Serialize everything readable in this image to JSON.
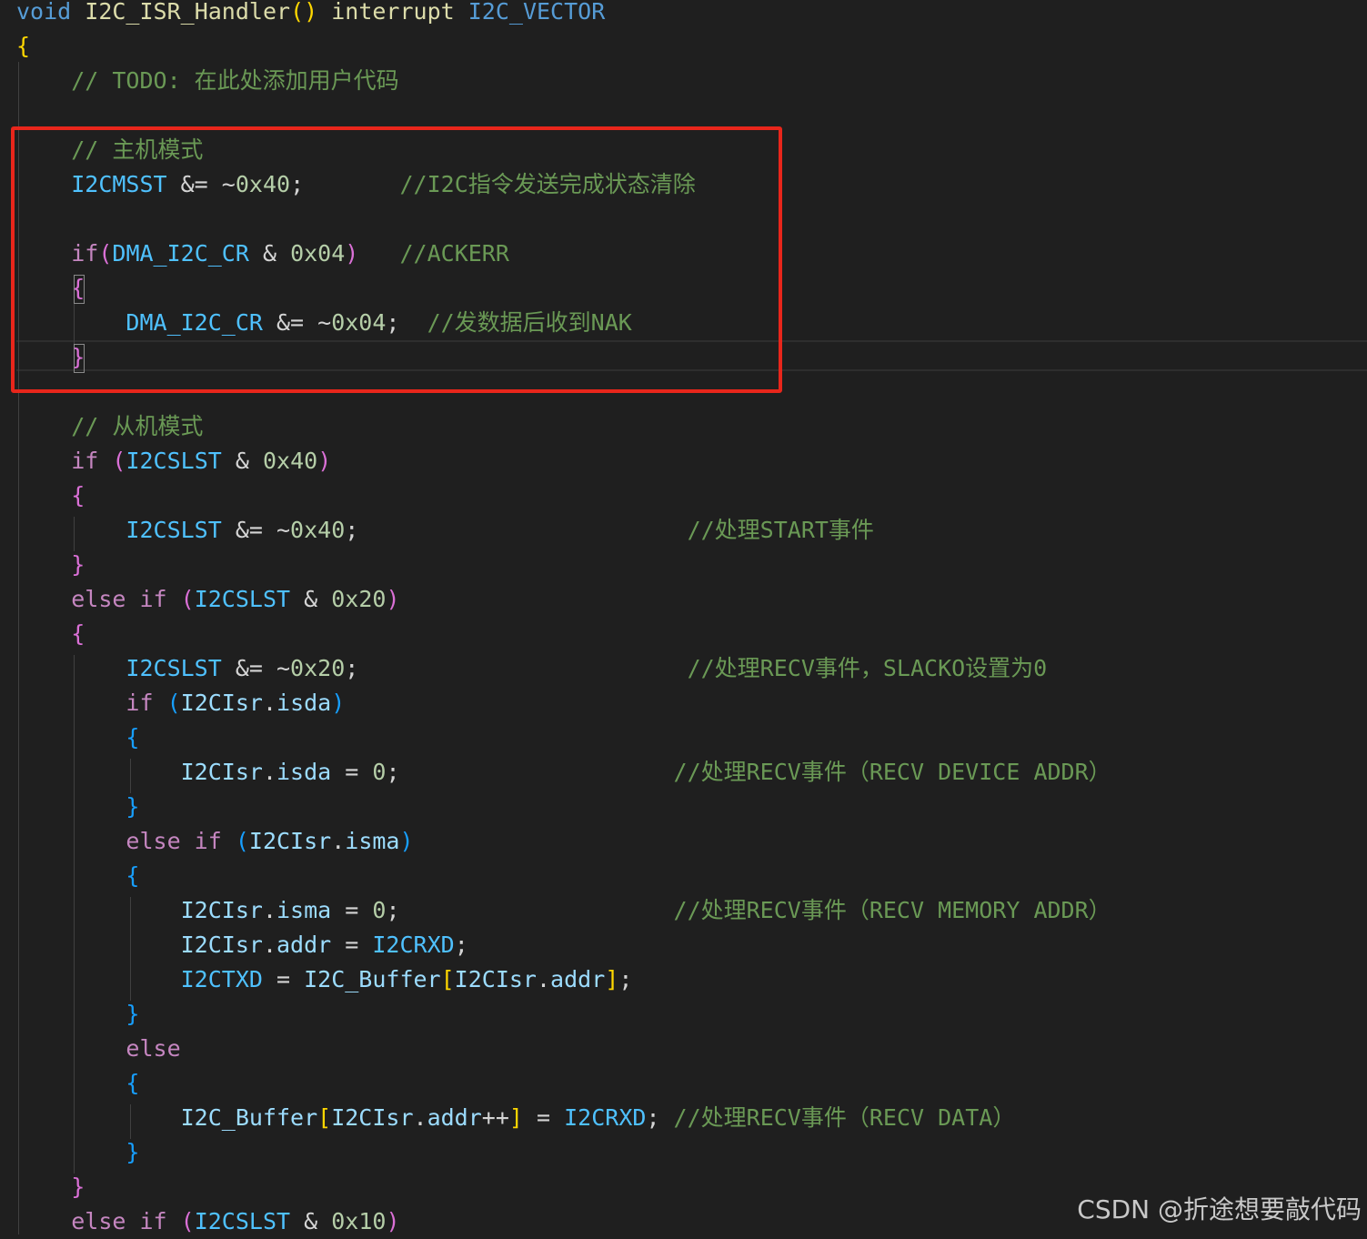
{
  "colors": {
    "background": "#1f1f1f",
    "highlight_box": "#e8261b",
    "keyword": "#569cd6",
    "control": "#c586c0",
    "function": "#dcdcaa",
    "variable": "#9cdcfe",
    "macro": "#4fc1ff",
    "number": "#b5cea8",
    "comment": "#6a9955",
    "operator": "#d4d4d4",
    "bracket_gold": "#ffd700",
    "bracket_purple": "#da70d6",
    "bracket_blue": "#179fff"
  },
  "code_lines": [
    {
      "tokens": [
        {
          "t": "void",
          "c": "keyword"
        },
        {
          "t": " ",
          "c": "operator"
        },
        {
          "t": "I2C_ISR_Handler",
          "c": "function"
        },
        {
          "t": "()",
          "c": "bracket_gold"
        },
        {
          "t": " interrupt ",
          "c": "function"
        },
        {
          "t": "I2C_VECTOR",
          "c": "keyword"
        }
      ]
    },
    {
      "tokens": [
        {
          "t": "{",
          "c": "bracket_gold"
        }
      ]
    },
    {
      "tokens": [
        {
          "t": "    // TODO: 在此处添加用户代码",
          "c": "comment"
        }
      ]
    },
    {
      "tokens": []
    },
    {
      "tokens": [
        {
          "t": "    // 主机模式",
          "c": "comment"
        }
      ]
    },
    {
      "tokens": [
        {
          "t": "    ",
          "c": "operator"
        },
        {
          "t": "I2CMSST",
          "c": "macro"
        },
        {
          "t": " &= ~",
          "c": "operator"
        },
        {
          "t": "0x40",
          "c": "number"
        },
        {
          "t": ";       ",
          "c": "operator"
        },
        {
          "t": "//I2C指令发送完成状态清除",
          "c": "comment"
        }
      ]
    },
    {
      "tokens": []
    },
    {
      "tokens": [
        {
          "t": "    ",
          "c": "operator"
        },
        {
          "t": "if",
          "c": "control"
        },
        {
          "t": "(",
          "c": "bracket_purple"
        },
        {
          "t": "DMA_I2C_CR",
          "c": "macro"
        },
        {
          "t": " & ",
          "c": "operator"
        },
        {
          "t": "0x04",
          "c": "number"
        },
        {
          "t": ")",
          "c": "bracket_purple"
        },
        {
          "t": "   ",
          "c": "operator"
        },
        {
          "t": "//ACKERR",
          "c": "comment"
        }
      ]
    },
    {
      "tokens": [
        {
          "t": "    ",
          "c": "operator"
        },
        {
          "t": "{",
          "c": "bracket_purple"
        }
      ]
    },
    {
      "tokens": [
        {
          "t": "        ",
          "c": "operator"
        },
        {
          "t": "DMA_I2C_CR",
          "c": "macro"
        },
        {
          "t": " &= ~",
          "c": "operator"
        },
        {
          "t": "0x04",
          "c": "number"
        },
        {
          "t": ";  ",
          "c": "operator"
        },
        {
          "t": "//发数据后收到NAK",
          "c": "comment"
        }
      ]
    },
    {
      "tokens": [
        {
          "t": "    ",
          "c": "operator"
        },
        {
          "t": "}",
          "c": "bracket_purple"
        }
      ]
    },
    {
      "tokens": []
    },
    {
      "tokens": [
        {
          "t": "    // 从机模式",
          "c": "comment"
        }
      ]
    },
    {
      "tokens": [
        {
          "t": "    ",
          "c": "operator"
        },
        {
          "t": "if",
          "c": "control"
        },
        {
          "t": " ",
          "c": "operator"
        },
        {
          "t": "(",
          "c": "bracket_purple"
        },
        {
          "t": "I2CSLST",
          "c": "macro"
        },
        {
          "t": " & ",
          "c": "operator"
        },
        {
          "t": "0x40",
          "c": "number"
        },
        {
          "t": ")",
          "c": "bracket_purple"
        }
      ]
    },
    {
      "tokens": [
        {
          "t": "    ",
          "c": "operator"
        },
        {
          "t": "{",
          "c": "bracket_purple"
        }
      ]
    },
    {
      "tokens": [
        {
          "t": "        ",
          "c": "operator"
        },
        {
          "t": "I2CSLST",
          "c": "macro"
        },
        {
          "t": " &= ~",
          "c": "operator"
        },
        {
          "t": "0x40",
          "c": "number"
        },
        {
          "t": ";                        ",
          "c": "operator"
        },
        {
          "t": "//处理START事件",
          "c": "comment"
        }
      ]
    },
    {
      "tokens": [
        {
          "t": "    ",
          "c": "operator"
        },
        {
          "t": "}",
          "c": "bracket_purple"
        }
      ]
    },
    {
      "tokens": [
        {
          "t": "    ",
          "c": "operator"
        },
        {
          "t": "else if",
          "c": "control"
        },
        {
          "t": " ",
          "c": "operator"
        },
        {
          "t": "(",
          "c": "bracket_purple"
        },
        {
          "t": "I2CSLST",
          "c": "macro"
        },
        {
          "t": " & ",
          "c": "operator"
        },
        {
          "t": "0x20",
          "c": "number"
        },
        {
          "t": ")",
          "c": "bracket_purple"
        }
      ]
    },
    {
      "tokens": [
        {
          "t": "    ",
          "c": "operator"
        },
        {
          "t": "{",
          "c": "bracket_purple"
        }
      ]
    },
    {
      "tokens": [
        {
          "t": "        ",
          "c": "operator"
        },
        {
          "t": "I2CSLST",
          "c": "macro"
        },
        {
          "t": " &= ~",
          "c": "operator"
        },
        {
          "t": "0x20",
          "c": "number"
        },
        {
          "t": ";                        ",
          "c": "operator"
        },
        {
          "t": "//处理RECV事件，SLACKO设置为0",
          "c": "comment"
        }
      ]
    },
    {
      "tokens": [
        {
          "t": "        ",
          "c": "operator"
        },
        {
          "t": "if",
          "c": "control"
        },
        {
          "t": " ",
          "c": "operator"
        },
        {
          "t": "(",
          "c": "bracket_blue"
        },
        {
          "t": "I2CIsr",
          "c": "variable"
        },
        {
          "t": ".",
          "c": "operator"
        },
        {
          "t": "isda",
          "c": "variable"
        },
        {
          "t": ")",
          "c": "bracket_blue"
        }
      ]
    },
    {
      "tokens": [
        {
          "t": "        ",
          "c": "operator"
        },
        {
          "t": "{",
          "c": "bracket_blue"
        }
      ]
    },
    {
      "tokens": [
        {
          "t": "            ",
          "c": "operator"
        },
        {
          "t": "I2CIsr",
          "c": "variable"
        },
        {
          "t": ".",
          "c": "operator"
        },
        {
          "t": "isda",
          "c": "variable"
        },
        {
          "t": " = ",
          "c": "operator"
        },
        {
          "t": "0",
          "c": "number"
        },
        {
          "t": ";                    ",
          "c": "operator"
        },
        {
          "t": "//处理RECV事件（RECV DEVICE ADDR）",
          "c": "comment"
        }
      ]
    },
    {
      "tokens": [
        {
          "t": "        ",
          "c": "operator"
        },
        {
          "t": "}",
          "c": "bracket_blue"
        }
      ]
    },
    {
      "tokens": [
        {
          "t": "        ",
          "c": "operator"
        },
        {
          "t": "else if",
          "c": "control"
        },
        {
          "t": " ",
          "c": "operator"
        },
        {
          "t": "(",
          "c": "bracket_blue"
        },
        {
          "t": "I2CIsr",
          "c": "variable"
        },
        {
          "t": ".",
          "c": "operator"
        },
        {
          "t": "isma",
          "c": "variable"
        },
        {
          "t": ")",
          "c": "bracket_blue"
        }
      ]
    },
    {
      "tokens": [
        {
          "t": "        ",
          "c": "operator"
        },
        {
          "t": "{",
          "c": "bracket_blue"
        }
      ]
    },
    {
      "tokens": [
        {
          "t": "            ",
          "c": "operator"
        },
        {
          "t": "I2CIsr",
          "c": "variable"
        },
        {
          "t": ".",
          "c": "operator"
        },
        {
          "t": "isma",
          "c": "variable"
        },
        {
          "t": " = ",
          "c": "operator"
        },
        {
          "t": "0",
          "c": "number"
        },
        {
          "t": ";                    ",
          "c": "operator"
        },
        {
          "t": "//处理RECV事件（RECV MEMORY ADDR）",
          "c": "comment"
        }
      ]
    },
    {
      "tokens": [
        {
          "t": "            ",
          "c": "operator"
        },
        {
          "t": "I2CIsr",
          "c": "variable"
        },
        {
          "t": ".",
          "c": "operator"
        },
        {
          "t": "addr",
          "c": "variable"
        },
        {
          "t": " = ",
          "c": "operator"
        },
        {
          "t": "I2CRXD",
          "c": "macro"
        },
        {
          "t": ";",
          "c": "operator"
        }
      ]
    },
    {
      "tokens": [
        {
          "t": "            ",
          "c": "operator"
        },
        {
          "t": "I2CTXD",
          "c": "macro"
        },
        {
          "t": " = ",
          "c": "operator"
        },
        {
          "t": "I2C_Buffer",
          "c": "variable"
        },
        {
          "t": "[",
          "c": "bracket_gold"
        },
        {
          "t": "I2CIsr",
          "c": "variable"
        },
        {
          "t": ".",
          "c": "operator"
        },
        {
          "t": "addr",
          "c": "variable"
        },
        {
          "t": "]",
          "c": "bracket_gold"
        },
        {
          "t": ";",
          "c": "operator"
        }
      ]
    },
    {
      "tokens": [
        {
          "t": "        ",
          "c": "operator"
        },
        {
          "t": "}",
          "c": "bracket_blue"
        }
      ]
    },
    {
      "tokens": [
        {
          "t": "        ",
          "c": "operator"
        },
        {
          "t": "else",
          "c": "control"
        }
      ]
    },
    {
      "tokens": [
        {
          "t": "        ",
          "c": "operator"
        },
        {
          "t": "{",
          "c": "bracket_blue"
        }
      ]
    },
    {
      "tokens": [
        {
          "t": "            ",
          "c": "operator"
        },
        {
          "t": "I2C_Buffer",
          "c": "variable"
        },
        {
          "t": "[",
          "c": "bracket_gold"
        },
        {
          "t": "I2CIsr",
          "c": "variable"
        },
        {
          "t": ".",
          "c": "operator"
        },
        {
          "t": "addr",
          "c": "variable"
        },
        {
          "t": "++",
          "c": "operator"
        },
        {
          "t": "]",
          "c": "bracket_gold"
        },
        {
          "t": " = ",
          "c": "operator"
        },
        {
          "t": "I2CRXD",
          "c": "macro"
        },
        {
          "t": "; ",
          "c": "operator"
        },
        {
          "t": "//处理RECV事件（RECV DATA）",
          "c": "comment"
        }
      ]
    },
    {
      "tokens": [
        {
          "t": "        ",
          "c": "operator"
        },
        {
          "t": "}",
          "c": "bracket_blue"
        }
      ]
    },
    {
      "tokens": [
        {
          "t": "    ",
          "c": "operator"
        },
        {
          "t": "}",
          "c": "bracket_purple"
        }
      ]
    },
    {
      "tokens": [
        {
          "t": "    ",
          "c": "operator"
        },
        {
          "t": "else if",
          "c": "control"
        },
        {
          "t": " ",
          "c": "operator"
        },
        {
          "t": "(",
          "c": "bracket_purple"
        },
        {
          "t": "I2CSLST",
          "c": "macro"
        },
        {
          "t": " & ",
          "c": "operator"
        },
        {
          "t": "0x10",
          "c": "number"
        },
        {
          "t": ")",
          "c": "bracket_purple"
        }
      ]
    }
  ],
  "watermark": "CSDN @折途想要敲代码"
}
